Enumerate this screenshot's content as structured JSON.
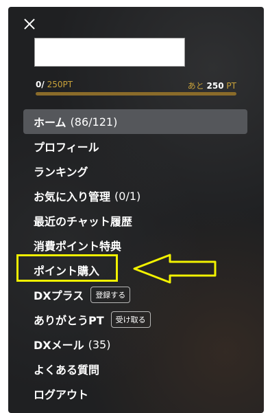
{
  "points": {
    "current": "0/",
    "max": "250PT",
    "remaining_prefix": "あと",
    "remaining_value": "250",
    "remaining_unit": "PT",
    "progress_fraction": 0
  },
  "menu": {
    "home": {
      "label": "ホーム",
      "count": "(86/121)"
    },
    "profile": {
      "label": "プロフィール"
    },
    "ranking": {
      "label": "ランキング"
    },
    "favorites": {
      "label": "お気に入り管理",
      "count": "(0/1)"
    },
    "recent_chat": {
      "label": "最近のチャット履歴"
    },
    "point_benefits": {
      "label": "消費ポイント特典"
    },
    "buy_points": {
      "label": "ポイント購入"
    },
    "dx_plus": {
      "label": "DXプラス",
      "button": "登録する"
    },
    "thanks": {
      "label": "ありがとうPT",
      "button": "受け取る"
    },
    "dx_mail": {
      "label": "DXメール",
      "count": "(35)"
    },
    "faq": {
      "label": "よくある質問"
    },
    "logout": {
      "label": "ログアウト"
    }
  },
  "colors": {
    "panel_bg": "#1f2022",
    "accent_gold": "#c9a23a",
    "highlight_yellow": "#f2f200",
    "active_item_bg": "#55575b"
  }
}
